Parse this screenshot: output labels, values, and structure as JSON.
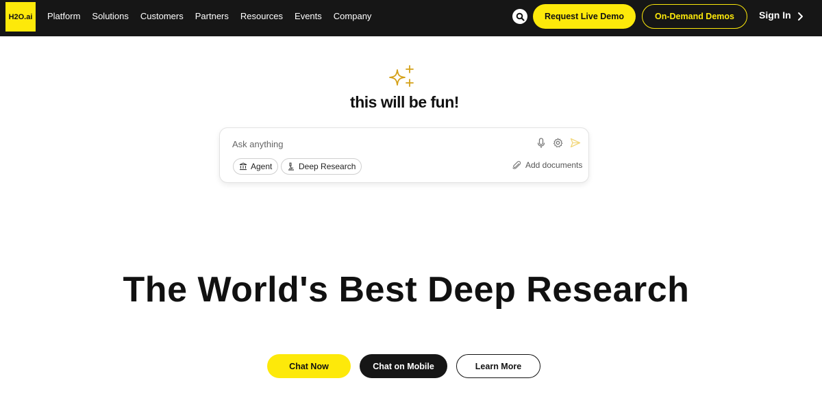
{
  "nav": {
    "logo_text": "H2O.ai",
    "links": [
      "Platform",
      "Solutions",
      "Customers",
      "Partners",
      "Resources",
      "Events",
      "Company"
    ],
    "search_icon": "search-icon",
    "request_demo_label": "Request Live Demo",
    "on_demand_label": "On-Demand Demos",
    "sign_in_label": "Sign In",
    "chevron_icon": "chevron-right-icon"
  },
  "hero": {
    "sparkle_icon": "sparkle-icon",
    "tagline": "this will be fun!",
    "chat": {
      "placeholder": "Ask anything",
      "value": "",
      "mic_icon": "microphone-icon",
      "settings_icon": "gear-icon",
      "send_icon": "send-icon",
      "chips": [
        {
          "label": "Agent",
          "icon": "agent-icon"
        },
        {
          "label": "Deep Research",
          "icon": "research-icon"
        }
      ],
      "add_documents_label": "Add documents",
      "attach_icon": "paperclip-icon"
    }
  },
  "headline": "The World's Best Deep Research",
  "ctas": {
    "chat_now": "Chat Now",
    "chat_mobile": "Chat on Mobile",
    "learn_more": "Learn More"
  },
  "colors": {
    "brand_yellow": "#fde90a",
    "nav_bg": "#161616",
    "sparkle_gold": "#d4a017"
  }
}
